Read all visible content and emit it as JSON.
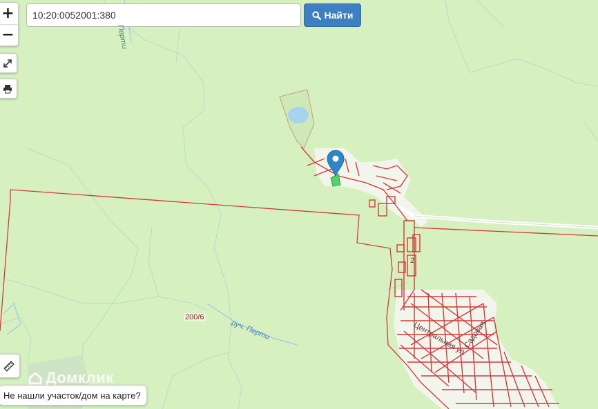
{
  "search": {
    "value": "10:20:0052001:380",
    "button_label": "Найти"
  },
  "controls": {
    "zoom_in": "+",
    "zoom_out": "−"
  },
  "map": {
    "parcel_label": "200/6",
    "river_label_bottom": "руч. Перти",
    "river_label_top": "Перти",
    "street_label": "Центральная ул.",
    "street_label_2": "Садовая",
    "street_label_3": "2"
  },
  "footer": {
    "not_found_text": "Не нашли участок/дом на карте?",
    "watermark": "Домклик"
  },
  "colors": {
    "background": "#d6f0c0",
    "boundary": "#d23a3a",
    "water": "#a7d3ef",
    "accent": "#3d7fc1",
    "marker": "#2e86c9"
  }
}
